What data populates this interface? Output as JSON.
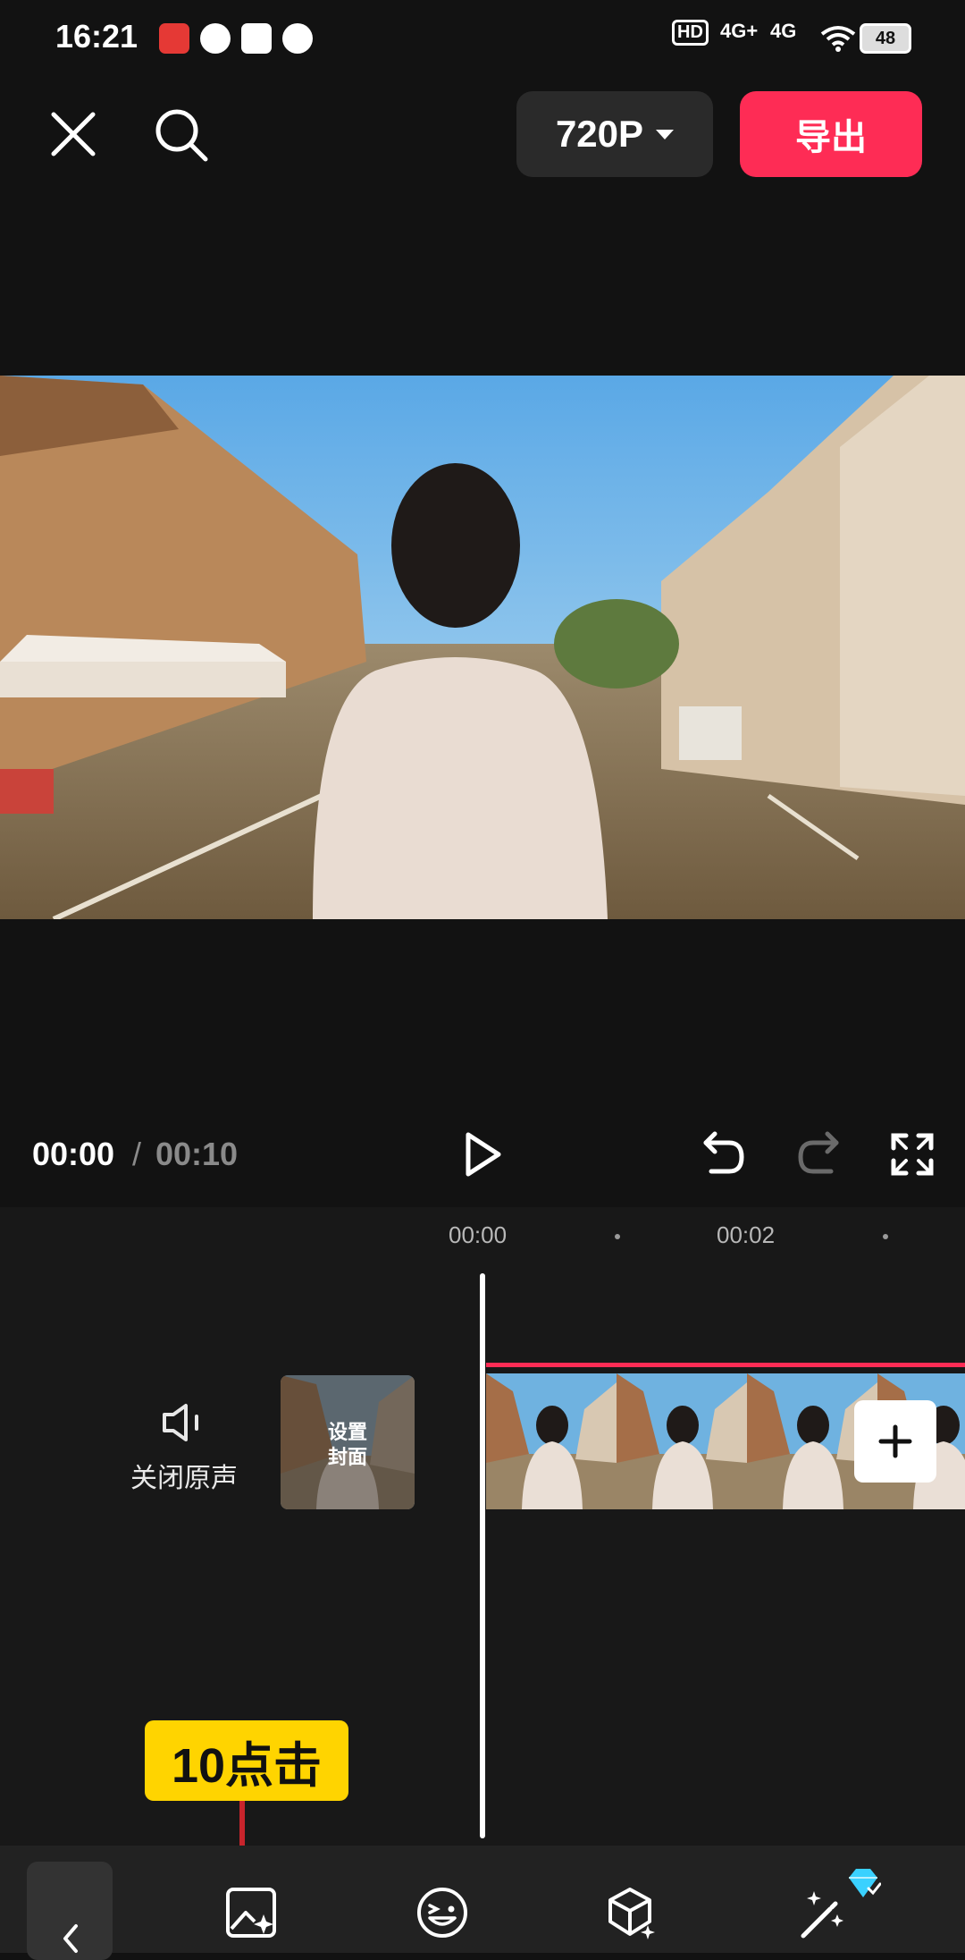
{
  "status_bar": {
    "time": "16:21",
    "hd_label": "HD",
    "signal1_label": "4G+",
    "signal2_label": "4G",
    "battery": "48"
  },
  "top_bar": {
    "resolution": "720P",
    "export_label": "导出"
  },
  "player": {
    "current_time": "00:00",
    "separator": "/",
    "total_time": "00:10"
  },
  "timeline": {
    "ruler_marks": [
      "00:00",
      "00:02"
    ],
    "mute_label": "关闭原声",
    "cover_label_line1": "设置",
    "cover_label_line2": "封面"
  },
  "annotation": {
    "text": "10点击"
  },
  "colors": {
    "accent": "#fe2c55",
    "background": "#121212",
    "annotation": "#ffd400",
    "arrow": "#c8242c"
  }
}
